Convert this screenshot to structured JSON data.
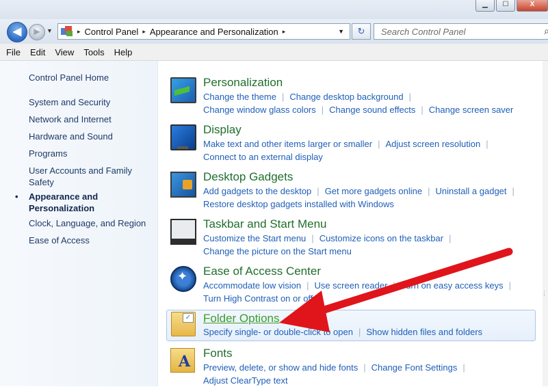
{
  "window": {
    "controls": [
      "▁",
      "☐",
      "X"
    ]
  },
  "nav": {
    "back_glyph": "◀",
    "forward_glyph": "▶",
    "breadcrumb": [
      "Control Panel",
      "Appearance and Personalization"
    ],
    "crumb_sep": "▸",
    "refresh_glyph": "↻",
    "search_placeholder": "Search Control Panel",
    "search_icon": "search-icon"
  },
  "menu": [
    "File",
    "Edit",
    "View",
    "Tools",
    "Help"
  ],
  "sidebar": {
    "items": [
      {
        "label": "Control Panel Home"
      },
      {
        "label": "System and Security"
      },
      {
        "label": "Network and Internet"
      },
      {
        "label": "Hardware and Sound"
      },
      {
        "label": "Programs"
      },
      {
        "label": "User Accounts and Family Safety"
      },
      {
        "label": "Appearance and Personalization",
        "current": true
      },
      {
        "label": "Clock, Language, and Region"
      },
      {
        "label": "Ease of Access"
      }
    ],
    "bullet": "•"
  },
  "categories": [
    {
      "title": "Personalization",
      "icon": "personalization-icon",
      "links": [
        "Change the theme",
        "Change desktop background",
        "Change window glass colors",
        "Change sound effects",
        "Change screen saver"
      ]
    },
    {
      "title": "Display",
      "icon": "display-icon",
      "links": [
        "Make text and other items larger or smaller",
        "Adjust screen resolution",
        "Connect to an external display"
      ]
    },
    {
      "title": "Desktop Gadgets",
      "icon": "desktop-gadgets-icon",
      "links": [
        "Add gadgets to the desktop",
        "Get more gadgets online",
        "Uninstall a gadget",
        "Restore desktop gadgets installed with Windows"
      ]
    },
    {
      "title": "Taskbar and Start Menu",
      "icon": "taskbar-icon",
      "links": [
        "Customize the Start menu",
        "Customize icons on the taskbar",
        "Change the picture on the Start menu"
      ]
    },
    {
      "title": "Ease of Access Center",
      "icon": "ease-of-access-icon",
      "links": [
        "Accommodate low vision",
        "Use screen reader",
        "Turn on easy access keys",
        "Turn High Contrast on or off"
      ]
    },
    {
      "title": "Folder Options",
      "icon": "folder-options-icon",
      "highlighted": true,
      "links": [
        "Specify single- or double-click to open",
        "Show hidden files and folders"
      ]
    },
    {
      "title": "Fonts",
      "icon": "fonts-icon",
      "links": [
        "Preview, delete, or show and hide fonts",
        "Change Font Settings",
        "Adjust ClearType text"
      ]
    }
  ],
  "colors": {
    "category_title": "#1f6e2c",
    "link": "#1f5fb8",
    "annotation_arrow": "#e0141b"
  }
}
